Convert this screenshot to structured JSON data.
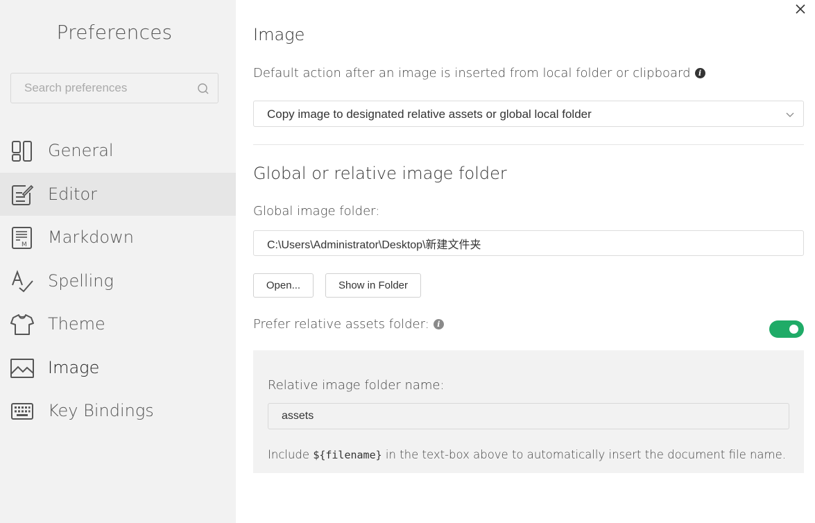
{
  "sidebar": {
    "title": "Preferences",
    "search_placeholder": "Search preferences",
    "items": [
      {
        "label": "General",
        "icon": "layout-icon"
      },
      {
        "label": "Editor",
        "icon": "edit-icon"
      },
      {
        "label": "Markdown",
        "icon": "markdown-icon"
      },
      {
        "label": "Spelling",
        "icon": "spellcheck-icon"
      },
      {
        "label": "Theme",
        "icon": "shirt-icon"
      },
      {
        "label": "Image",
        "icon": "image-icon"
      },
      {
        "label": "Key Bindings",
        "icon": "keyboard-icon"
      }
    ],
    "hovered_item": "Editor",
    "selected_item": "Image"
  },
  "main": {
    "title": "Image",
    "default_action_label": "Default action after an image is inserted from local folder or clipboard",
    "default_action_value": "Copy image to designated relative assets or global local folder",
    "folder_section_title": "Global or relative image folder",
    "global_folder_label": "Global image folder:",
    "global_folder_value": "C:\\Users\\Administrator\\Desktop\\新建文件夹",
    "open_button": "Open...",
    "show_in_folder_button": "Show in Folder",
    "prefer_relative_label": "Prefer relative assets folder:",
    "prefer_relative_enabled": true,
    "relative_folder_label": "Relative image folder name:",
    "relative_folder_value": "assets",
    "hint_prefix": "Include",
    "hint_code": "${filename}",
    "hint_suffix": "in the text-box above to automatically insert the document file name."
  },
  "colors": {
    "accent_toggle": "#1fab67",
    "sidebar_bg": "#f2f2f2",
    "sidebar_hover": "#e6e6e6",
    "info_icon_dark": "#333333",
    "info_icon_gray": "#8a8a8a"
  }
}
